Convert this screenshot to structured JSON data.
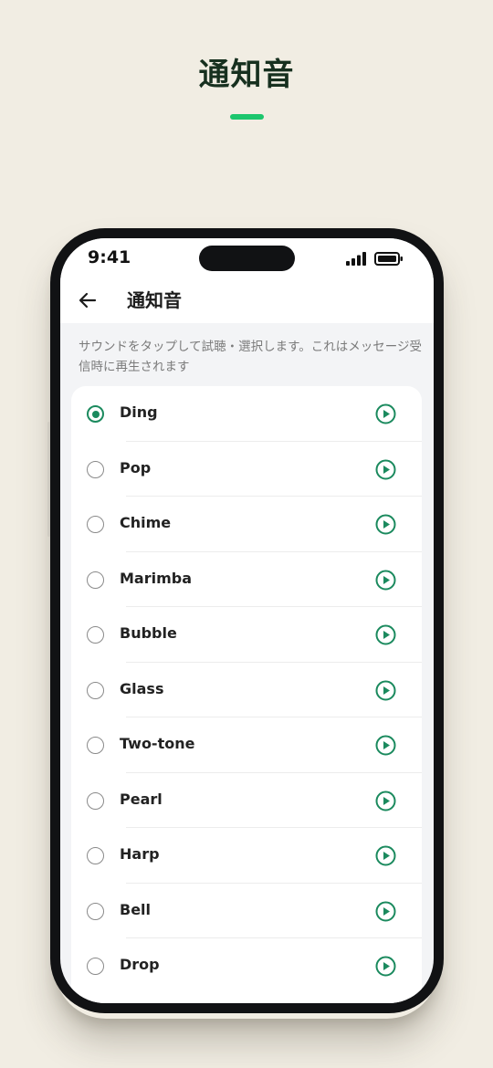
{
  "hero": {
    "title": "通知音"
  },
  "status_bar": {
    "time": "9:41"
  },
  "app_bar": {
    "title": "通知音"
  },
  "description": "サウンドをタップして試聴・選択します。これはメッセージ受信時に再生されます",
  "sounds": [
    {
      "name": "Ding",
      "selected": true
    },
    {
      "name": "Pop",
      "selected": false
    },
    {
      "name": "Chime",
      "selected": false
    },
    {
      "name": "Marimba",
      "selected": false
    },
    {
      "name": "Bubble",
      "selected": false
    },
    {
      "name": "Glass",
      "selected": false
    },
    {
      "name": "Two-tone",
      "selected": false
    },
    {
      "name": "Pearl",
      "selected": false
    },
    {
      "name": "Harp",
      "selected": false
    },
    {
      "name": "Bell",
      "selected": false
    },
    {
      "name": "Drop",
      "selected": false
    }
  ],
  "colors": {
    "accent": "#1b8a5e",
    "hero_accent": "#1cc66d",
    "background": "#f1ede3"
  },
  "icons": {
    "back": "arrow-left-icon",
    "play": "play-circle-icon",
    "signal": "signal-icon",
    "battery": "battery-icon"
  }
}
